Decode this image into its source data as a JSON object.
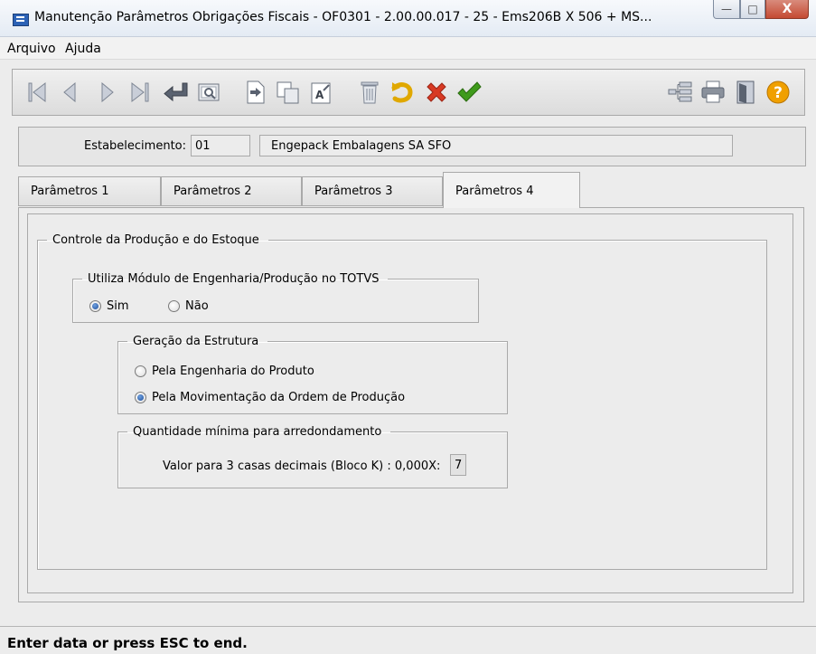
{
  "window": {
    "title": "Manutenção Parâmetros Obrigações Fiscais - OF0301 - 2.00.00.017 - 25 - Ems206B X 506 + MS...",
    "controls": {
      "minimize": "—",
      "maximize": "□",
      "close": "X"
    }
  },
  "menu": {
    "items": [
      "Arquivo",
      "Ajuda"
    ]
  },
  "toolbar": {
    "icons": [
      "first-icon",
      "previous-icon",
      "next-icon",
      "last-icon",
      "goto-icon",
      "search-icon",
      "new-icon",
      "copy-icon",
      "edit-icon",
      "delete-icon",
      "undo-icon",
      "cancel-icon",
      "confirm-icon",
      "tree-icon",
      "print-icon",
      "exit-icon",
      "help-icon"
    ],
    "help_label": "?"
  },
  "establishment": {
    "label": "Estabelecimento:",
    "code": "01",
    "name": "Engepack Embalagens SA SFO"
  },
  "tabs": [
    {
      "label": "Parâmetros 1",
      "active": false
    },
    {
      "label": "Parâmetros 2",
      "active": false
    },
    {
      "label": "Parâmetros 3",
      "active": false
    },
    {
      "label": "Parâmetros 4",
      "active": true
    }
  ],
  "main": {
    "section_title": "Controle da Produção e do Estoque",
    "module_group": {
      "title": "Utiliza Módulo de Engenharia/Produção no TOTVS",
      "options": [
        {
          "label": "Sim",
          "selected": true
        },
        {
          "label": "Não",
          "selected": false
        }
      ]
    },
    "structure_group": {
      "title": "Geração da Estrutura",
      "options": [
        {
          "label": "Pela Engenharia do Produto",
          "selected": false
        },
        {
          "label": "Pela Movimentação da Ordem de Produção",
          "selected": true
        }
      ]
    },
    "rounding_group": {
      "title": "Quantidade mínima para arredondamento",
      "field_label": "Valor para 3 casas decimais (Bloco K) : 0,000X:",
      "field_value": "7"
    }
  },
  "status": {
    "text": "Enter data or press ESC to end."
  },
  "colors": {
    "accent": "#2c62b6",
    "help": "#f0a000",
    "cancel": "#d83a24",
    "confirm": "#3f9a1b",
    "undo": "#e0a800"
  }
}
